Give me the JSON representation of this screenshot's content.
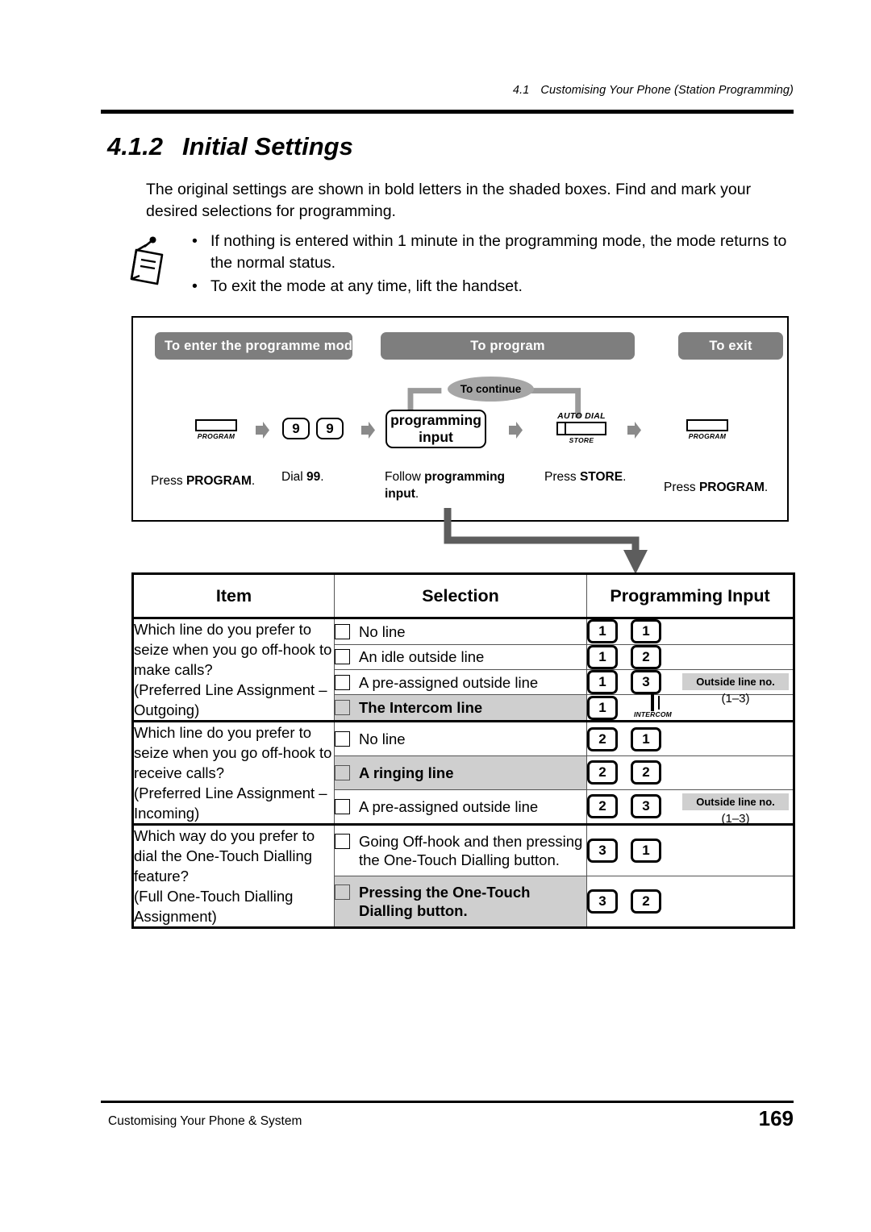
{
  "header": {
    "section_number": "4.1",
    "section_title": "Customising Your Phone (Station Programming)"
  },
  "title": {
    "number": "4.1.2",
    "text": "Initial Settings"
  },
  "intro": "The original settings are shown in bold letters in the shaded boxes. Find and mark your desired selections for programming.",
  "notes": {
    "icon": "note-pad-icon",
    "bullet": "•",
    "items": [
      "If nothing is entered within 1 minute in the programming mode, the mode returns to the normal status.",
      "To exit the mode at any time, lift the handset."
    ]
  },
  "procedure": {
    "banners": [
      {
        "label": "To enter the programme mode"
      },
      {
        "label": "To program"
      },
      {
        "label": "To exit"
      }
    ],
    "continue_label": "To continue",
    "steps": [
      {
        "type": "key",
        "key_label": "PROGRAM",
        "caption_plain": "Press ",
        "caption_bold": "PROGRAM",
        "caption_tail": "."
      },
      {
        "type": "digits",
        "digits": [
          "9",
          "9"
        ],
        "caption_plain": "Dial ",
        "caption_bold": "99",
        "caption_tail": "."
      },
      {
        "type": "inputbox",
        "line1": "programming",
        "line2": "input",
        "caption_plain": "Follow ",
        "caption_bold": "programming input",
        "caption_tail": "."
      },
      {
        "type": "key2",
        "key_top": "AUTO DIAL",
        "key_label": "STORE",
        "caption_plain": "Press ",
        "caption_bold": "STORE",
        "caption_tail": "."
      },
      {
        "type": "key",
        "key_label": "PROGRAM",
        "caption_plain": "Press ",
        "caption_bold": "PROGRAM",
        "caption_tail": "."
      }
    ]
  },
  "table": {
    "columns": [
      "Item",
      "Selection",
      "Programming Input"
    ],
    "blocks": [
      {
        "item": "Which line do you prefer to seize when you go off-hook to make calls?\n(Preferred Line Assignment – Outgoing)",
        "rows": [
          {
            "selection": "No line",
            "keys": [
              "1",
              "1"
            ],
            "default": false
          },
          {
            "selection": "An idle outside line",
            "keys": [
              "1",
              "2"
            ],
            "default": false
          },
          {
            "selection": "A pre-assigned outside line",
            "keys": [
              "1",
              "3"
            ],
            "default": false,
            "tag": {
              "label": "Outside line no.",
              "range": "(1–3)"
            }
          },
          {
            "selection": "The Intercom line",
            "keys": [
              "1"
            ],
            "default": true,
            "extra_key": "INTERCOM"
          }
        ]
      },
      {
        "item": "Which line do you prefer to seize when you go off-hook to receive calls?\n(Preferred Line Assignment – Incoming)",
        "rows": [
          {
            "selection": "No line",
            "keys": [
              "2",
              "1"
            ],
            "default": false
          },
          {
            "selection": "A ringing line",
            "keys": [
              "2",
              "2"
            ],
            "default": true
          },
          {
            "selection": "A pre-assigned outside line",
            "keys": [
              "2",
              "3"
            ],
            "default": false,
            "tag": {
              "label": "Outside line no.",
              "range": "(1–3)"
            }
          }
        ]
      },
      {
        "item": "Which way do you prefer to dial the One-Touch Dialling feature?\n(Full One-Touch Dialling Assignment)",
        "rows": [
          {
            "selection": "Going Off-hook and then pressing the One-Touch Dialling button.",
            "keys": [
              "3",
              "1"
            ],
            "default": false
          },
          {
            "selection": "Pressing the One-Touch Dialling button.",
            "keys": [
              "3",
              "2"
            ],
            "default": true
          }
        ]
      }
    ]
  },
  "footer": {
    "left": "Customising Your Phone & System",
    "page": "169"
  },
  "colors": {
    "banner": "#7e7e7e",
    "shade": "#cfcfcf",
    "arrow": "#808080",
    "pill": "#a6a6a6"
  }
}
